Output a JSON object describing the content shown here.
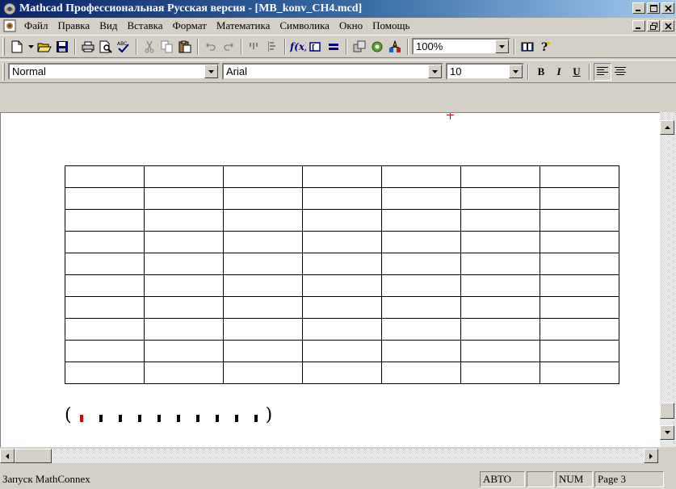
{
  "window": {
    "title": "Mathcad Профессиональная Русская версия - [MB_konv_CH4.mcd]"
  },
  "menu": {
    "items": [
      {
        "label": "Файл"
      },
      {
        "label": "Правка"
      },
      {
        "label": "Вид"
      },
      {
        "label": "Вставка"
      },
      {
        "label": "Формат"
      },
      {
        "label": "Математика"
      },
      {
        "label": "Символика"
      },
      {
        "label": "Окно"
      },
      {
        "label": "Помощь"
      }
    ]
  },
  "toolbar": {
    "zoom": "100%"
  },
  "format_bar": {
    "style": "Normal",
    "font": "Arial",
    "size": "10",
    "bold": "B",
    "italic": "I",
    "underline": "U"
  },
  "document": {
    "table": {
      "rows": 10,
      "cols": 7
    },
    "vector": {
      "open": "(",
      "close": ")",
      "placeholders": 10
    }
  },
  "status": {
    "message": "Запуск MathConnex",
    "auto": "АВТО",
    "num": "NUM",
    "page": "Page 3"
  }
}
